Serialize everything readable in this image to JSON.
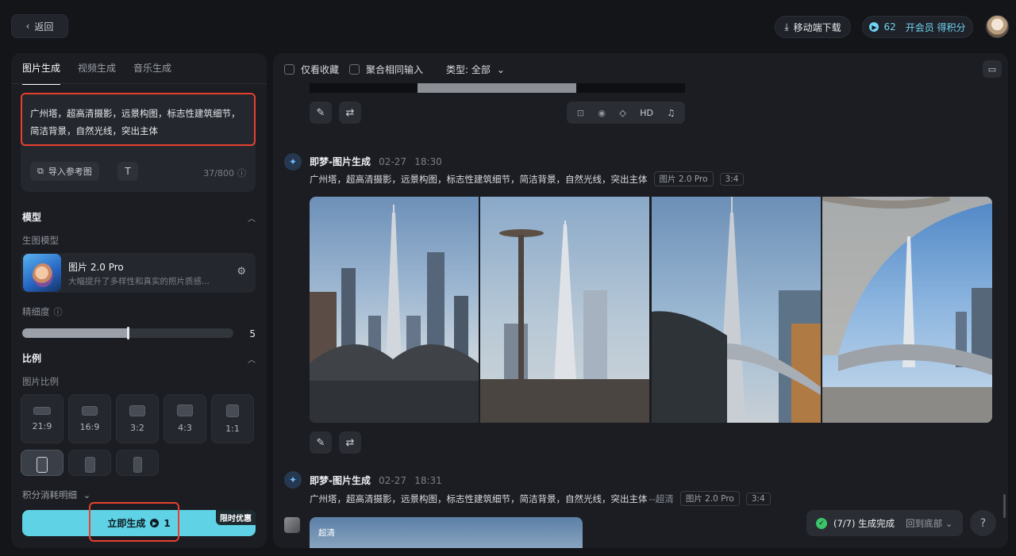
{
  "topbar": {
    "back_label": "返回",
    "mobile_download_label": "移动端下载",
    "credits": "62",
    "vip_label": "开会员 得积分"
  },
  "left": {
    "tabs": [
      {
        "label": "图片生成",
        "active": true
      },
      {
        "label": "视频生成",
        "active": false
      },
      {
        "label": "音乐生成",
        "active": false
      }
    ],
    "prompt": "广州塔，超高清摄影，远景构图，标志性建筑细节，简洁背景，自然光线，突出主体",
    "import_ref_label": "导入参考图",
    "char_count": "37/800",
    "model_section_title": "模型",
    "model_sub_label": "生图模型",
    "model_name": "图片 2.0 Pro",
    "model_desc": "大幅提升了多样性和真实的照片质感...",
    "precision_label": "精细度",
    "precision_value": "5",
    "precision_fraction": 0.5,
    "ratio_section_title": "比例",
    "ratio_sub_label": "图片比例",
    "ratios": [
      "21:9",
      "16:9",
      "3:2",
      "4:3",
      "1:1"
    ],
    "cost_detail_label": "积分消耗明细",
    "generate_label": "立即生成",
    "generate_cost": "1",
    "promo_badge": "限时优惠"
  },
  "main": {
    "filter_favorites": "仅看收藏",
    "filter_merge": "聚合相同输入",
    "filter_type": "类型: 全部",
    "tool_hd": "HD",
    "entries": [
      {
        "source": "即梦-图片生成",
        "date": "02-27",
        "time": "18:30",
        "prompt": "广州塔，超高清摄影，远景构图，标志性建筑细节，简洁背景，自然光线，突出主体",
        "model_tag": "图片 2.0 Pro",
        "ratio_tag": "3:4"
      },
      {
        "source": "即梦-图片生成",
        "date": "02-27",
        "time": "18:31",
        "prompt": "广州塔，超高清摄影，远景构图，标志性建筑细节，简洁背景，自然光线，突出主体",
        "suffix": "--超清",
        "model_tag": "图片 2.0 Pro",
        "ratio_tag": "3:4",
        "image_label": "超清"
      }
    ],
    "status_text": "(7/7) 生成完成",
    "back_to_bottom": "回到底部",
    "help": "?"
  }
}
